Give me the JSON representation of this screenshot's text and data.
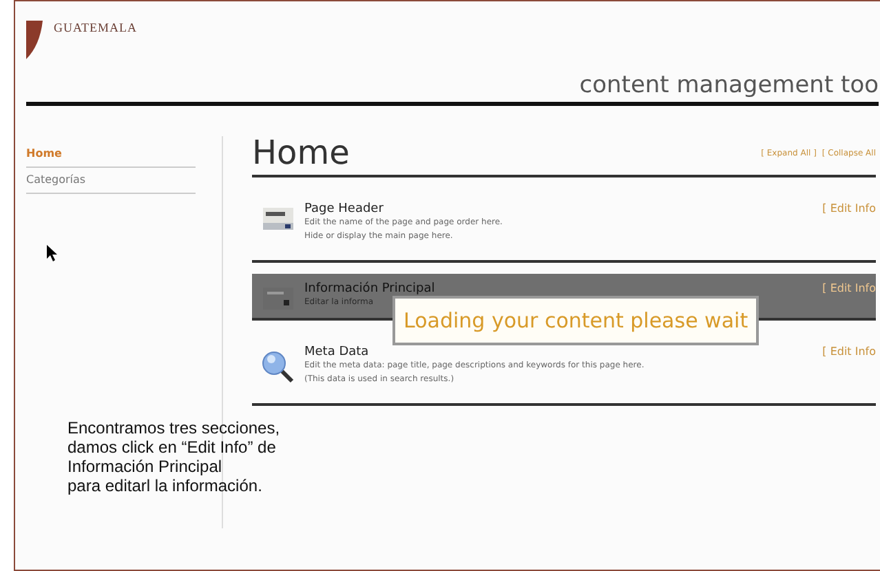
{
  "logo": {
    "text": "GUATEMALA"
  },
  "header": {
    "title": "content management too"
  },
  "sidebar": {
    "items": [
      {
        "label": "Home",
        "selected": true
      },
      {
        "label": "Categorías",
        "selected": false
      }
    ]
  },
  "main": {
    "title": "Home",
    "actions": [
      "[ Expand All ]",
      "[ Collapse All"
    ],
    "sections": [
      {
        "kind": "header",
        "title": "Page Header",
        "description": [
          "Edit the name of the page and page order here.",
          "Hide or display the main page here."
        ],
        "link": "[ Edit Info",
        "dimmed": false
      },
      {
        "kind": "news",
        "title": "Información Principal",
        "description": [
          "Editar la informa"
        ],
        "link": "[ Edit Info",
        "dimmed": true
      },
      {
        "kind": "search",
        "title": "Meta Data",
        "description": [
          "Edit the meta data: page title, page descriptions and keywords for this page here.",
          "(This data is used in search results.)"
        ],
        "link": "[ Edit Info",
        "dimmed": false
      }
    ]
  },
  "loading": {
    "text": "Loading your content please wait"
  },
  "caption": {
    "lines": [
      "Encontramos tres secciones,",
      "damos click en “Edit Info” de",
      "Información Principal",
      "para editarl la información."
    ]
  }
}
